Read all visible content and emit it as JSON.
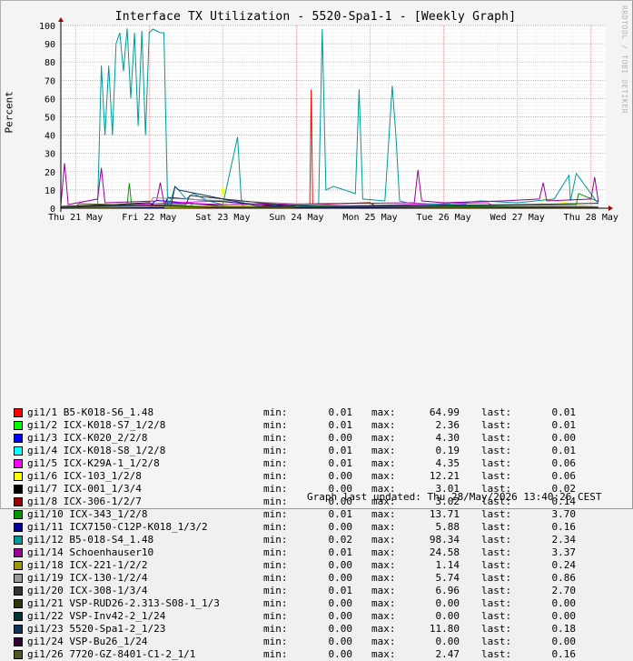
{
  "chart_data": {
    "type": "line",
    "title": "Interface TX Utilization - 5520-Spa1-1 - [Weekly Graph]",
    "ylabel": "Percent",
    "xlabel": "",
    "ylim": [
      0,
      100
    ],
    "yticks": [
      0,
      10,
      20,
      30,
      40,
      50,
      60,
      70,
      80,
      90,
      100
    ],
    "xticks": [
      "Thu 21 May",
      "Fri 22 May",
      "Sat 23 May",
      "Sun 24 May",
      "Mon 25 May",
      "Tue 26 May",
      "Wed 27 May",
      "Thu 28 May"
    ],
    "grid": true,
    "legend_position": "bottom",
    "x_unit": "days since Wed 20 May 2026 00:00 (approx)",
    "series": [
      {
        "name": "gi1/1 B5-K018-S6_1.48",
        "color": "#ff0000",
        "min": "0.01",
        "max": "64.99",
        "last": "0.01",
        "x": [
          0.8,
          4.0,
          4.18,
          4.2,
          4.22,
          5.0,
          8.1
        ],
        "values": [
          0.5,
          0.3,
          0.5,
          64.99,
          0.5,
          0.3,
          0.2
        ]
      },
      {
        "name": "gi1/2 ICX-K018-S7_1/2/8",
        "color": "#00ff00",
        "min": "0.01",
        "max": "2.36",
        "last": "0.01",
        "x": [
          0.8,
          2.5,
          2.6,
          3.4,
          3.5,
          6.0,
          8.1
        ],
        "values": [
          0.2,
          0.3,
          2.36,
          0.2,
          2.0,
          0.3,
          0.2
        ]
      },
      {
        "name": "gi1/3 ICX-K020_2/2/8",
        "color": "#0000ff",
        "min": "0.00",
        "max": "4.30",
        "last": "0.00",
        "x": [
          0.8,
          2.0,
          2.1,
          3.2,
          5.5,
          6.3,
          6.4,
          8.1
        ],
        "values": [
          0.5,
          1.5,
          4.3,
          0.5,
          0.8,
          2.0,
          0.5,
          0.3
        ]
      },
      {
        "name": "gi1/4 ICX-K018-S8_1/2/8",
        "color": "#00ffff",
        "min": "0.01",
        "max": "0.19",
        "last": "0.01",
        "x": [
          0.8,
          3.0,
          5.0,
          8.1
        ],
        "values": [
          0.1,
          0.19,
          0.05,
          0.01
        ]
      },
      {
        "name": "gi1/5 ICX-K29A-1_1/2/8",
        "color": "#ff00ff",
        "min": "0.01",
        "max": "4.35",
        "last": "0.06",
        "x": [
          0.8,
          3.2,
          3.3,
          4.0,
          6.6,
          6.7,
          8.1
        ],
        "values": [
          0.5,
          4.35,
          0.5,
          0.6,
          3.0,
          0.5,
          0.3
        ]
      },
      {
        "name": "gi1/6 ICX-103_1/2/8",
        "color": "#ffff00",
        "min": "0.00",
        "max": "12.21",
        "last": "0.06",
        "x": [
          0.8,
          2.95,
          3.0,
          3.05,
          6.0,
          7.3,
          7.35,
          8.1
        ],
        "values": [
          0.3,
          0.5,
          12.21,
          0.5,
          0.4,
          0.6,
          5.0,
          0.2
        ]
      },
      {
        "name": "gi1/7 ICX-001_1/3/4",
        "color": "#000000",
        "min": "0.00",
        "max": "3.01",
        "last": "0.02",
        "x": [
          0.8,
          1.5,
          2.0,
          2.1,
          4.5,
          6.0,
          8.1
        ],
        "values": [
          1.0,
          2.0,
          3.01,
          1.0,
          0.8,
          1.2,
          0.5
        ]
      },
      {
        "name": "gi1/8 ICX-306-1/2/7",
        "color": "#990000",
        "min": "0.00",
        "max": "3.02",
        "last": "0.14",
        "x": [
          0.8,
          2.0,
          3.0,
          5.0,
          5.1,
          8.1
        ],
        "values": [
          0.5,
          1.0,
          0.5,
          3.02,
          0.5,
          0.3
        ]
      },
      {
        "name": "gi1/10 ICX-343_1/2/8",
        "color": "#009900",
        "min": "0.01",
        "max": "13.71",
        "last": "3.70",
        "x": [
          0.8,
          1.7,
          1.73,
          1.76,
          3.0,
          5.5,
          7.8,
          7.83,
          8.1
        ],
        "values": [
          0.5,
          2.0,
          13.71,
          2.0,
          0.8,
          1.0,
          2.0,
          8.0,
          3.7
        ]
      },
      {
        "name": "gi1/11 ICX7150-C12P-K018_1/3/2",
        "color": "#000099",
        "min": "0.00",
        "max": "5.88",
        "last": "0.16",
        "x": [
          0.8,
          2.2,
          2.25,
          4.0,
          6.5,
          8.1
        ],
        "values": [
          0.3,
          0.5,
          5.88,
          0.5,
          0.4,
          0.2
        ]
      },
      {
        "name": "gi1/12 B5-018-S4_1.48",
        "color": "#009999",
        "min": "0.02",
        "max": "98.34",
        "last": "2.34",
        "x": [
          0.8,
          1.3,
          1.35,
          1.4,
          1.45,
          1.5,
          1.55,
          1.6,
          1.65,
          1.7,
          1.75,
          1.8,
          1.85,
          1.9,
          1.95,
          2.0,
          2.05,
          2.1,
          2.15,
          2.2,
          2.25,
          2.3,
          2.35,
          2.4,
          2.5,
          2.6,
          2.8,
          3.0,
          3.2,
          3.25,
          3.3,
          3.6,
          4.0,
          4.3,
          4.35,
          4.4,
          4.5,
          4.8,
          4.85,
          4.9,
          5.2,
          5.3,
          5.35,
          5.4,
          5.5,
          6.0,
          6.5,
          7.0,
          7.5,
          7.7,
          7.72,
          7.8,
          8.1
        ],
        "values": [
          0.5,
          1.0,
          78.0,
          40.0,
          78.0,
          40.0,
          90.0,
          96.0,
          75.0,
          98.34,
          60.0,
          96.0,
          45.0,
          97.0,
          40.0,
          96.0,
          98.0,
          97.0,
          96.0,
          96.0,
          2.0,
          5.0,
          12.0,
          10.0,
          5.0,
          8.0,
          4.0,
          2.0,
          39.0,
          5.0,
          2.0,
          3.0,
          1.0,
          2.0,
          98.0,
          10.0,
          12.0,
          8.0,
          65.0,
          5.0,
          4.0,
          67.0,
          40.0,
          4.0,
          3.0,
          2.0,
          4.0,
          3.0,
          5.0,
          18.0,
          4.0,
          19.0,
          2.34
        ]
      },
      {
        "name": "gi1/14 Schoenhauser10",
        "color": "#990099",
        "min": "0.01",
        "max": "24.58",
        "last": "3.37",
        "x": [
          0.8,
          0.85,
          0.9,
          1.3,
          1.35,
          1.4,
          2.1,
          2.15,
          2.2,
          3.0,
          5.6,
          5.65,
          5.7,
          6.0,
          6.8,
          7.3,
          7.35,
          7.4,
          8.0,
          8.05,
          8.1
        ],
        "values": [
          2.0,
          24.58,
          2.0,
          5.0,
          22.0,
          3.0,
          4.0,
          14.0,
          3.0,
          2.0,
          3.0,
          21.0,
          4.0,
          3.0,
          4.0,
          5.0,
          14.0,
          4.0,
          5.0,
          17.0,
          3.37
        ]
      },
      {
        "name": "gi1/18 ICX-221-1/2/2",
        "color": "#999900",
        "min": "0.00",
        "max": "1.14",
        "last": "0.24",
        "x": [
          0.8,
          3.0,
          6.0,
          8.1
        ],
        "values": [
          0.3,
          1.14,
          0.5,
          0.24
        ]
      },
      {
        "name": "gi1/19 ICX-130-1/2/4",
        "color": "#999999",
        "min": "0.00",
        "max": "5.74",
        "last": "0.86",
        "x": [
          0.8,
          2.0,
          2.05,
          5.0,
          7.9,
          8.1
        ],
        "values": [
          0.5,
          1.0,
          5.74,
          0.8,
          1.2,
          0.86
        ]
      },
      {
        "name": "gi1/20 ICX-308-1/3/4",
        "color": "#333333",
        "min": "0.01",
        "max": "6.96",
        "last": "2.70",
        "x": [
          0.8,
          2.5,
          2.55,
          4.0,
          7.0,
          8.1
        ],
        "values": [
          1.0,
          2.0,
          6.96,
          1.0,
          2.0,
          2.7
        ]
      },
      {
        "name": "gi1/21 VSP-RUD26-2.313-S08-1_1/3",
        "color": "#333300",
        "min": "0.00",
        "max": "0.00",
        "last": "0.00",
        "x": [
          0.8,
          8.1
        ],
        "values": [
          0.0,
          0.0
        ]
      },
      {
        "name": "gi1/22 VSP-Inv42-2_1/24",
        "color": "#003333",
        "min": "0.00",
        "max": "0.00",
        "last": "0.00",
        "x": [
          0.8,
          8.1
        ],
        "values": [
          0.0,
          0.0
        ]
      },
      {
        "name": "gi1/23 5520-Spa1-2_1/23",
        "color": "#113355",
        "min": "0.00",
        "max": "11.80",
        "last": "0.18",
        "x": [
          0.8,
          2.3,
          2.35,
          2.4,
          3.5,
          6.5,
          8.1
        ],
        "values": [
          0.5,
          2.0,
          11.8,
          10.0,
          1.0,
          1.0,
          0.18
        ]
      },
      {
        "name": "gi1/24 VSP-Bu26_1/24",
        "color": "#330033",
        "min": "0.00",
        "max": "0.00",
        "last": "0.00",
        "x": [
          0.8,
          8.1
        ],
        "values": [
          0.0,
          0.0
        ]
      },
      {
        "name": "gi1/26 7720-GZ-8401-C1-2_1/1",
        "color": "#555522",
        "min": "0.00",
        "max": "2.47",
        "last": "0.16",
        "x": [
          0.8,
          1.0,
          1.05,
          3.0,
          6.0,
          8.1
        ],
        "values": [
          0.5,
          1.0,
          2.47,
          0.5,
          0.8,
          0.16
        ]
      }
    ]
  },
  "labels": {
    "min": "min:",
    "max": "max:",
    "last": "last:"
  },
  "watermark": "RRDTOOL / TOBI OETIKER",
  "updated": "Graph last updated: Thu 28/May/2026 13:40:26 CEST"
}
